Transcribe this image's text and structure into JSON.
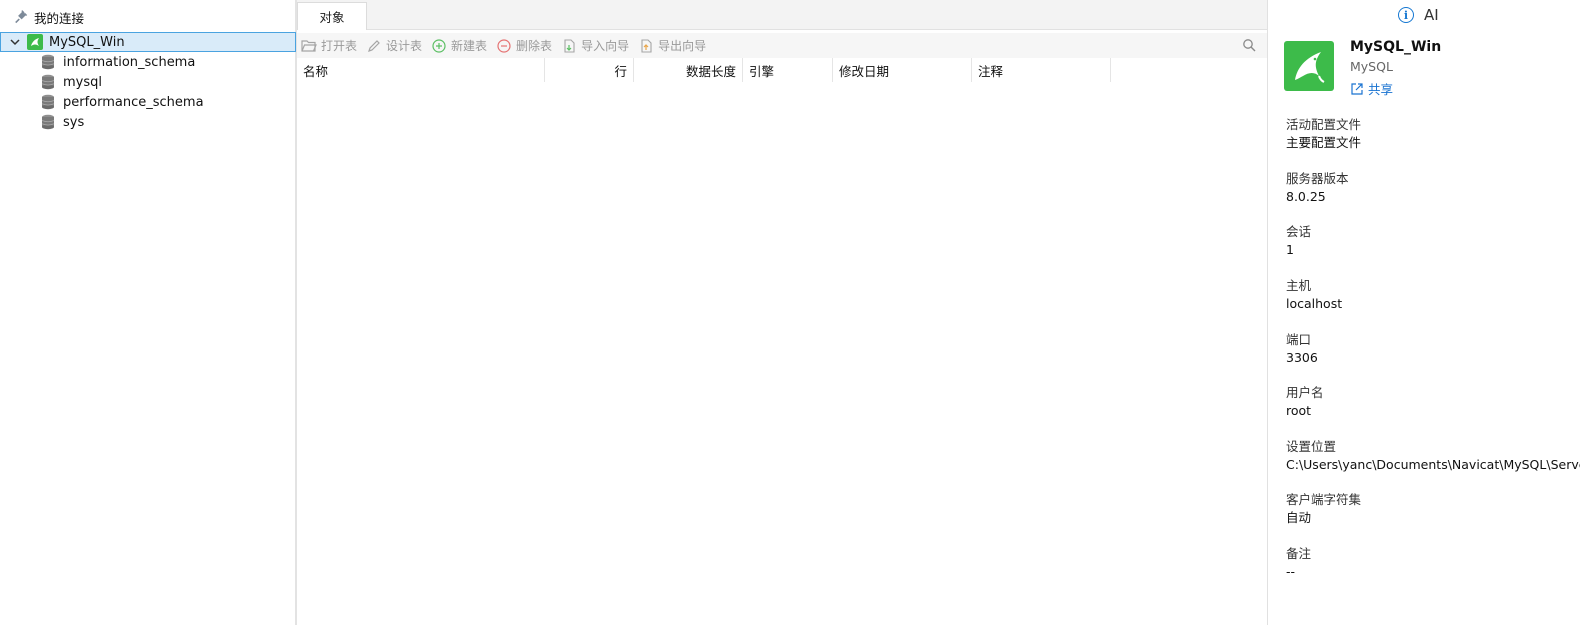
{
  "left": {
    "header_title": "我的连接",
    "connection": {
      "name": "MySQL_Win"
    },
    "databases": [
      {
        "name": "information_schema"
      },
      {
        "name": "mysql"
      },
      {
        "name": "performance_schema"
      },
      {
        "name": "sys"
      }
    ]
  },
  "middle": {
    "tab_label": "对象",
    "toolbar": {
      "open": "打开表",
      "design": "设计表",
      "new": "新建表",
      "delete": "删除表",
      "import": "导入向导",
      "export": "导出向导"
    },
    "columns": [
      "名称",
      "行",
      "数据长度",
      "引擎",
      "修改日期",
      "注释"
    ]
  },
  "right": {
    "ai_label": "AI",
    "name": "MySQL_Win",
    "type": "MySQL",
    "share_label": "共享",
    "fields": [
      {
        "label": "活动配置文件",
        "value": "主要配置文件"
      },
      {
        "label": "服务器版本",
        "value": "8.0.25"
      },
      {
        "label": "会话",
        "value": "1"
      },
      {
        "label": "主机",
        "value": "localhost"
      },
      {
        "label": "端口",
        "value": "3306"
      },
      {
        "label": "用户名",
        "value": "root"
      },
      {
        "label": "设置位置",
        "value": "C:\\Users\\yanc\\Documents\\Navicat\\MySQL\\Servers\\MySQL_Win"
      },
      {
        "label": "客户端字符集",
        "value": "自动"
      },
      {
        "label": "备注",
        "value": "--"
      }
    ]
  },
  "colors": {
    "accent": "#1678d2",
    "mysql_green": "#3dbb4a",
    "selection_bg": "#d9ebf9",
    "selection_border": "#4aa3e0"
  }
}
